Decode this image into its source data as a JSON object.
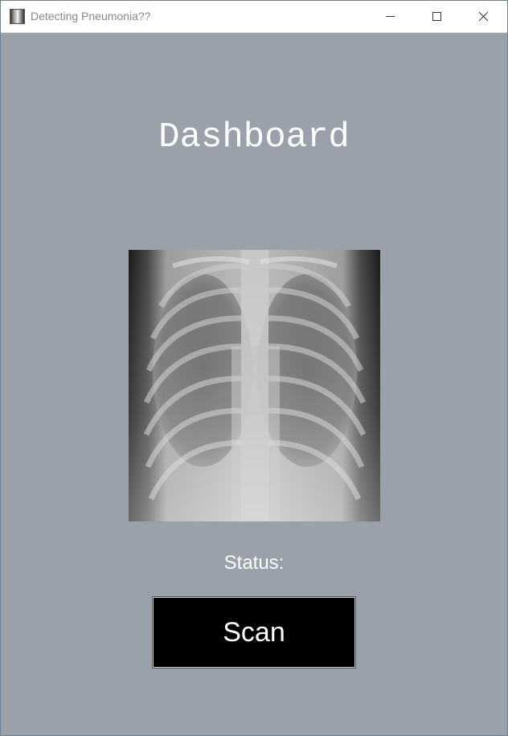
{
  "window": {
    "title": "Detecting Pneumonia??",
    "icon": "xray-app-icon",
    "controls": [
      "minimize-icon",
      "maximize-icon",
      "close-icon"
    ]
  },
  "main": {
    "heading": "Dashboard",
    "image": {
      "description_icon": "chest-xray-image"
    },
    "status_label": "Status:",
    "scan_button_label": "Scan"
  },
  "colors": {
    "background": "#9aa1ab",
    "heading_text": "#ffffff",
    "button_background": "#000000",
    "button_text": "#ffffff"
  }
}
